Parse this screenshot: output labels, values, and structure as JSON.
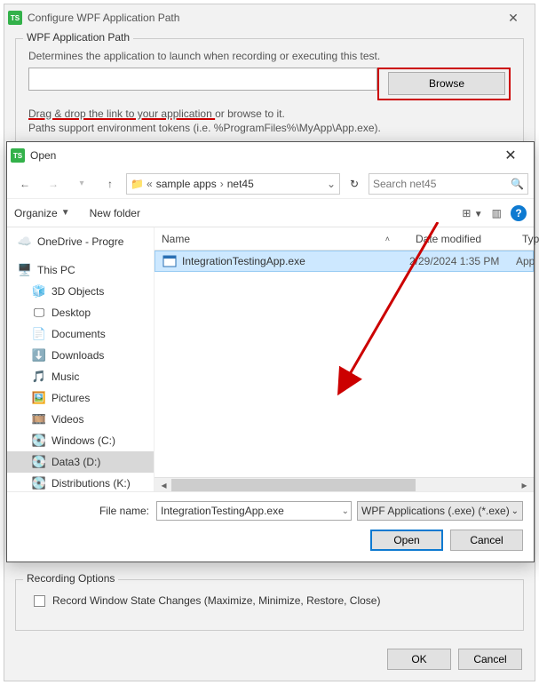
{
  "dialog": {
    "title": "Configure WPF Application Path",
    "wpf_group": {
      "legend": "WPF Application Path",
      "description": "Determines the application to launch when recording or executing this test.",
      "path_value": "",
      "browse_label": "Browse",
      "hint_drag": "Drag & drop the link to your application ",
      "hint_browse": "or browse to it.",
      "hint_tokens": "Paths support environment tokens (i.e. %ProgramFiles%\\MyApp\\App.exe)."
    },
    "recording_group": {
      "legend": "Recording Options",
      "record_window_state": "Record Window State Changes (Maximize, Minimize, Restore, Close)"
    },
    "buttons": {
      "ok": "OK",
      "cancel": "Cancel"
    }
  },
  "open": {
    "title": "Open",
    "crumbs": {
      "root_glyph": "«",
      "seg1": "sample apps",
      "seg2": "net45"
    },
    "search_placeholder": "Search net45",
    "toolbar": {
      "organize": "Organize",
      "new_folder": "New folder"
    },
    "columns": {
      "name": "Name",
      "modified": "Date modified",
      "type": "Type"
    },
    "tree": {
      "onedrive": "OneDrive - Progre",
      "this_pc": "This PC",
      "objects3d": "3D Objects",
      "desktop": "Desktop",
      "documents": "Documents",
      "downloads": "Downloads",
      "music": "Music",
      "pictures": "Pictures",
      "videos": "Videos",
      "win_c": "Windows (C:)",
      "data_d": "Data3 (D:)",
      "dist_k": "Distributions (K:)"
    },
    "files": [
      {
        "name": "IntegrationTestingApp.exe",
        "modified": "2/29/2024 1:35 PM",
        "type": "App"
      }
    ],
    "filename_label": "File name:",
    "filename_value": "IntegrationTestingApp.exe",
    "filter_value": "WPF Applications (.exe) (*.exe)",
    "buttons": {
      "open": "Open",
      "cancel": "Cancel"
    }
  }
}
